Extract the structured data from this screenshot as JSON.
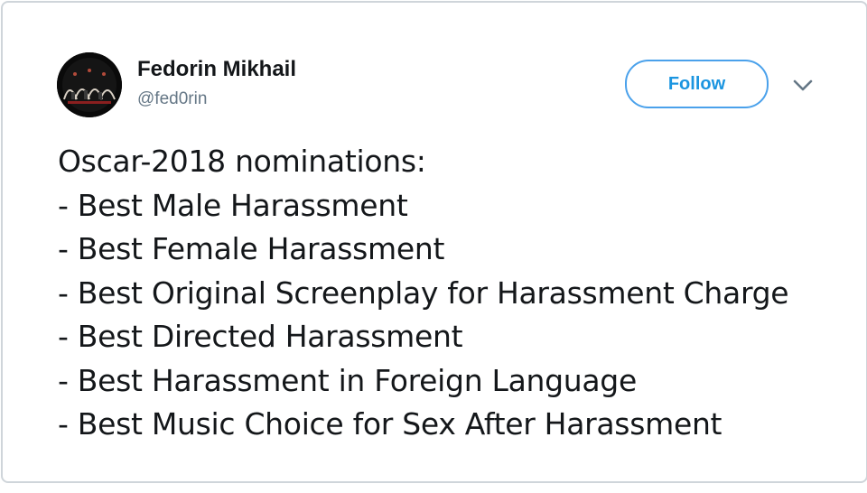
{
  "author": {
    "display_name": "Fedorin Mikhail",
    "handle": "@fed0rin",
    "avatar_icon": "avatar-image"
  },
  "actions": {
    "follow_label": "Follow",
    "more_icon": "chevron-down-icon"
  },
  "tweet": {
    "lines": [
      "Oscar-2018 nominations:",
      "- Best Male Harassment",
      "- Best Female Harassment",
      "- Best Original Screenplay for Harassment Charge",
      "- Best Directed Harassment",
      "- Best Harassment in Foreign Language",
      "- Best Music Choice for Sex After Harassment"
    ]
  },
  "colors": {
    "accent": "#1b95e0",
    "text": "#14171a",
    "secondary_text": "#657786",
    "border": "#cfd5da"
  }
}
